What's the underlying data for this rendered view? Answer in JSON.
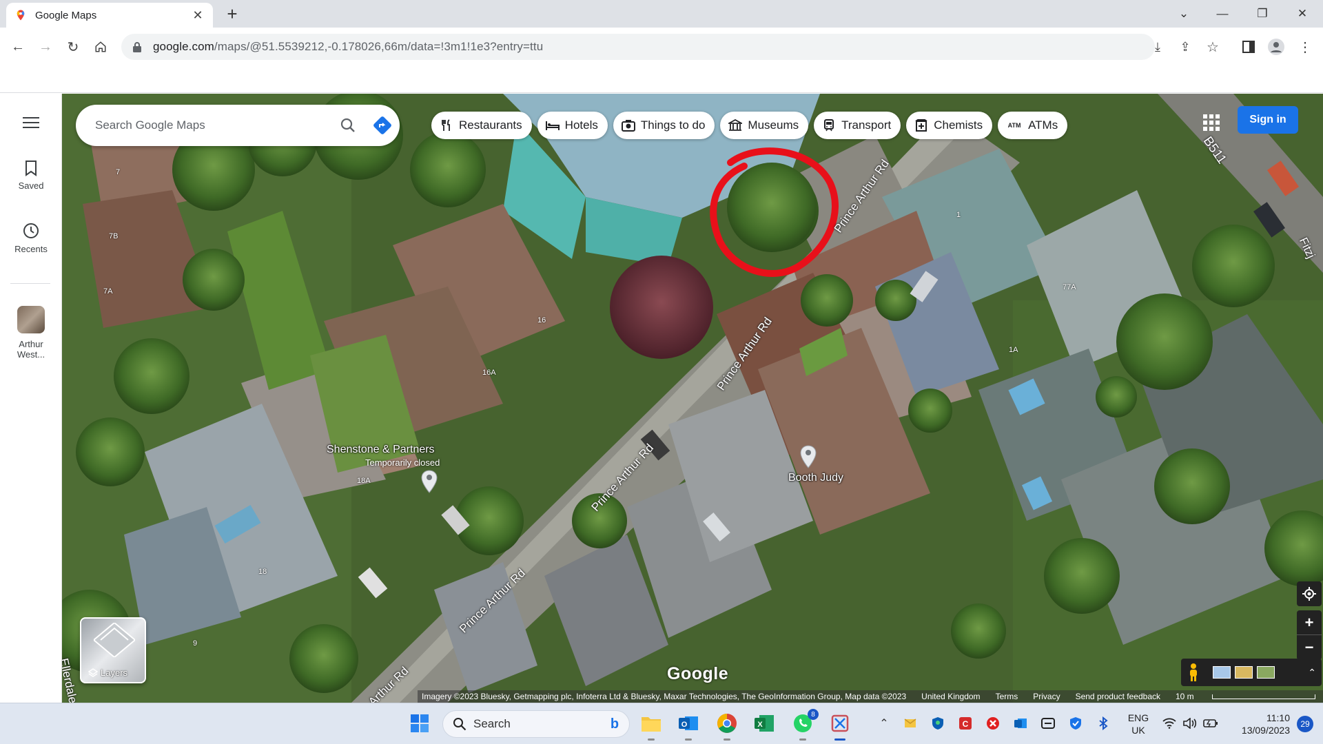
{
  "browser": {
    "tab_title": "Google Maps",
    "url_host": "google.com",
    "url_path": "/maps/@51.5539212,-0.178026,66m/data=!3m1!1e3?entry=ttu"
  },
  "rail": {
    "saved": "Saved",
    "recents": "Recents",
    "recent_place_line1": "Arthur",
    "recent_place_line2": "West..."
  },
  "search": {
    "placeholder": "Search Google Maps"
  },
  "chips": [
    {
      "label": "Restaurants",
      "icon": "fork-knife-icon"
    },
    {
      "label": "Hotels",
      "icon": "bed-icon"
    },
    {
      "label": "Things to do",
      "icon": "camera-icon"
    },
    {
      "label": "Museums",
      "icon": "museum-icon"
    },
    {
      "label": "Transport",
      "icon": "train-icon"
    },
    {
      "label": "Chemists",
      "icon": "pharmacy-icon"
    },
    {
      "label": "ATMs",
      "icon": "atm-icon"
    }
  ],
  "signin": "Sign in",
  "map_labels": {
    "shenstone": "Shenstone & Partners",
    "shenstone_status": "Temporarily closed",
    "booth_judy": "Booth Judy",
    "road": "Prince Arthur Rd",
    "road_fragment": "Arthur Rd",
    "ellerdale": "Ellerdale",
    "b511": "B511",
    "fitz": "Fitzj",
    "house_numbers": [
      "7",
      "7B",
      "7A",
      "16",
      "16A",
      "18A",
      "18",
      "9",
      "77A",
      "1A",
      "1"
    ]
  },
  "layers_label": "Layers",
  "google_logo": "Google",
  "attribution": {
    "imagery": "Imagery ©2023 Bluesky, Getmapping plc, Infoterra Ltd & Bluesky, Maxar Technologies, The GeoInformation Group, Map data ©2023",
    "region": "United Kingdom",
    "terms": "Terms",
    "privacy": "Privacy",
    "feedback": "Send product feedback",
    "scale": "10 m"
  },
  "taskbar": {
    "search": "Search",
    "whatsapp_badge": "8",
    "lang_line1": "ENG",
    "lang_line2": "UK",
    "time": "11:10",
    "date": "13/09/2023",
    "notifications": "29"
  },
  "colors": {
    "accent": "#1a73e8",
    "annotation_circle": "#e8101a"
  }
}
